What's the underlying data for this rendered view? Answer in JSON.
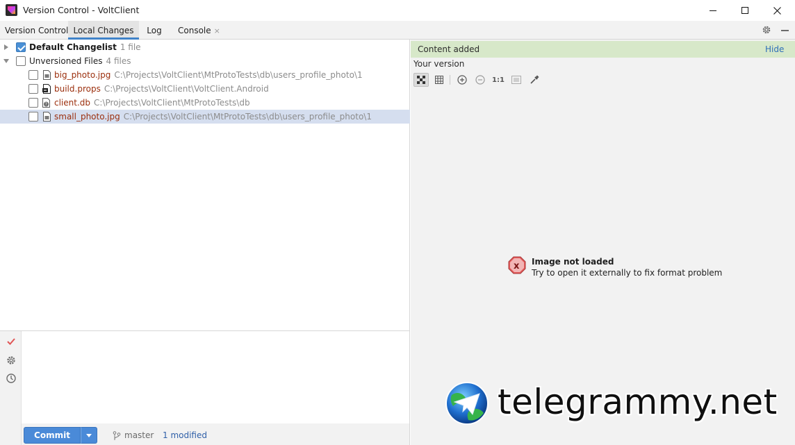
{
  "window": {
    "title": "Version Control - VoltClient",
    "icon": "rider-app-icon"
  },
  "tabs": {
    "label": "Version Control:",
    "items": [
      {
        "label": "Local Changes",
        "active": true
      },
      {
        "label": "Log",
        "active": false
      },
      {
        "label": "Console",
        "active": false
      }
    ],
    "close_glyph": "×"
  },
  "tree": {
    "default_changelist": {
      "label": "Default Changelist",
      "meta": "1 file",
      "checked": true
    },
    "unversioned": {
      "label": "Unversioned Files",
      "meta": "4 files",
      "checked": false
    },
    "files": [
      {
        "name": "big_photo.jpg",
        "path": "C:\\Projects\\VoltClient\\MtProtoTests\\db\\users_profile_photo\\1",
        "icon": "image-file-icon"
      },
      {
        "name": "build.props",
        "path": "C:\\Projects\\VoltClient\\VoltClient.Android",
        "icon": "props-file-icon"
      },
      {
        "name": "client.db",
        "path": "C:\\Projects\\VoltClient\\MtProtoTests\\db",
        "icon": "unknown-file-icon"
      },
      {
        "name": "small_photo.jpg",
        "path": "C:\\Projects\\VoltClient\\MtProtoTests\\db\\users_profile_photo\\1",
        "icon": "image-file-icon",
        "selected": true
      }
    ]
  },
  "viewer": {
    "notification": "Content added",
    "hide_label": "Hide",
    "version_label": "Your version",
    "zoom_actual_label": "1:1",
    "error_title": "Image not loaded",
    "error_subtitle": "Try to open it externally to fix format problem"
  },
  "commit": {
    "button_label": "Commit",
    "branch": "master",
    "status": "1 modified"
  },
  "watermark": {
    "text": "telegrammy.net"
  },
  "colors": {
    "accent": "#4a8ad8",
    "notify_bg": "#d7e8c9",
    "file_name": "#9b2e0c",
    "link": "#2f6fb8"
  }
}
